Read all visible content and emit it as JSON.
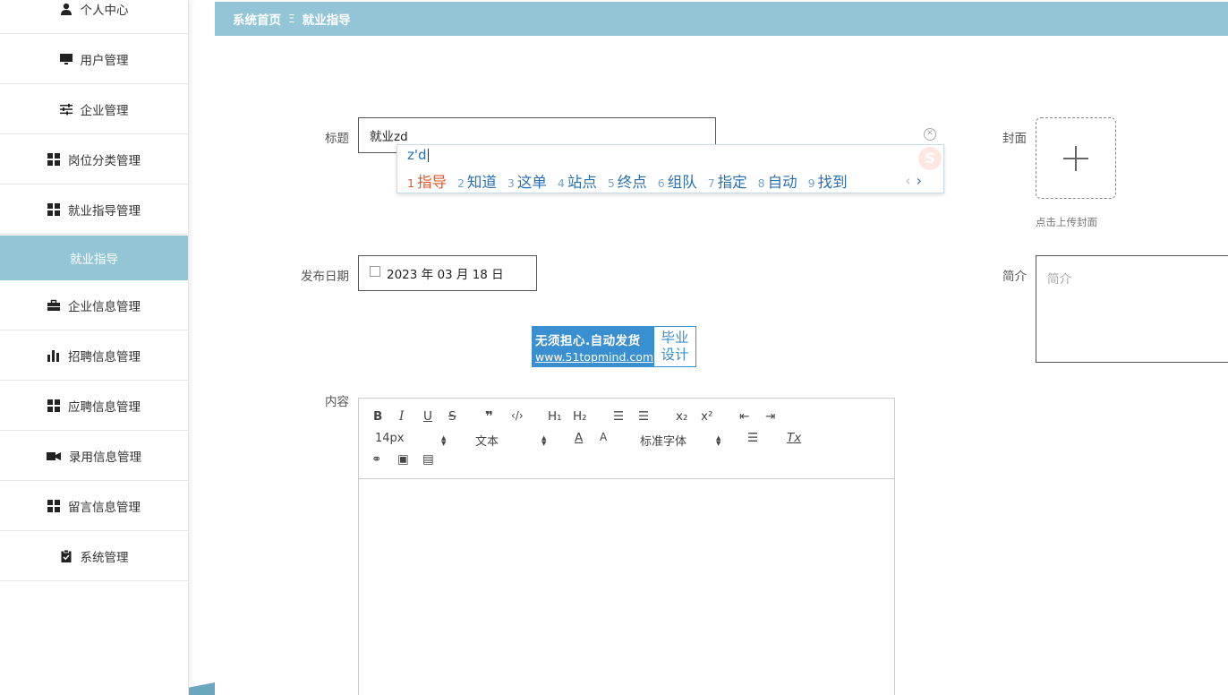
{
  "sidebar": {
    "items": [
      {
        "label": "个人中心",
        "icon": "user-icon"
      },
      {
        "label": "用户管理",
        "icon": "monitor-icon"
      },
      {
        "label": "企业管理",
        "icon": "sliders-icon"
      },
      {
        "label": "岗位分类管理",
        "icon": "grid-icon"
      },
      {
        "label": "就业指导管理",
        "icon": "grid-icon"
      },
      {
        "label": "就业指导",
        "active": true
      },
      {
        "label": "企业信息管理",
        "icon": "briefcase-icon"
      },
      {
        "label": "招聘信息管理",
        "icon": "bar-chart-icon"
      },
      {
        "label": "应聘信息管理",
        "icon": "grid-icon"
      },
      {
        "label": "录用信息管理",
        "icon": "camera-icon"
      },
      {
        "label": "留言信息管理",
        "icon": "grid-icon"
      },
      {
        "label": "系统管理",
        "icon": "clipboard-check-icon"
      }
    ]
  },
  "breadcrumb": {
    "home": "系统首页",
    "separator": "Ξ",
    "current": "就业指导"
  },
  "form": {
    "title_label": "标题",
    "title_value": "就业zd",
    "cover_label": "封面",
    "cover_hint": "点击上传封面",
    "date_label": "发布日期",
    "date_value": "2023 年 03 月 18 日",
    "intro_label": "简介",
    "intro_placeholder": "简介",
    "content_label": "内容"
  },
  "ime": {
    "input": "z'd",
    "candidates": [
      {
        "num": "1",
        "text": "指导"
      },
      {
        "num": "2",
        "text": "知道"
      },
      {
        "num": "3",
        "text": "这单"
      },
      {
        "num": "4",
        "text": "站点"
      },
      {
        "num": "5",
        "text": "终点"
      },
      {
        "num": "6",
        "text": "组队"
      },
      {
        "num": "7",
        "text": "指定"
      },
      {
        "num": "8",
        "text": "自动"
      },
      {
        "num": "9",
        "text": "找到"
      }
    ],
    "prev": "‹",
    "next": "›"
  },
  "ad": {
    "line1": "无须担心.自动发货",
    "line2": "www.51topmind.com",
    "right1": "毕业",
    "right2": "设计"
  },
  "editor": {
    "bold": "B",
    "italic": "I",
    "underline": "U",
    "strike": "S",
    "quote": "❞",
    "code": "‹/›",
    "h1": "H₁",
    "h2": "H₂",
    "ordered": "☰",
    "bullet": "☰",
    "sub": "x₂",
    "sup": "x²",
    "outdent": "⇤",
    "indent": "⇥",
    "size": "14px",
    "format": "文本",
    "font": "标准字体",
    "font_color": "A",
    "bg_color": "A",
    "align": "☰",
    "clean": "Tx",
    "link": "⚭",
    "image": "▣",
    "video": "▤"
  },
  "colors": {
    "accent": "#93c5d7",
    "ime_text": "#2a6fb0",
    "ime_first": "#e0582a"
  }
}
